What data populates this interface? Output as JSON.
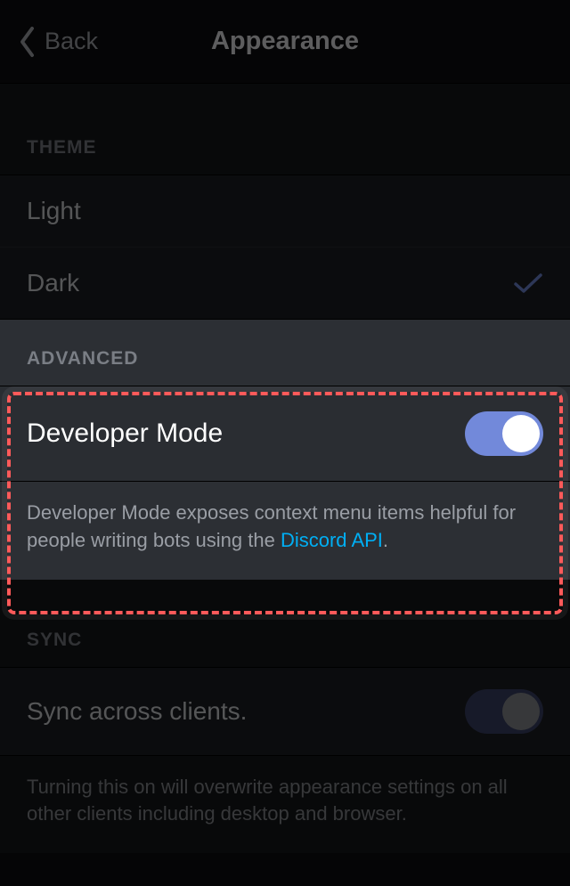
{
  "header": {
    "back_label": "Back",
    "title": "Appearance"
  },
  "sections": {
    "theme": {
      "header": "THEME",
      "options": {
        "light": {
          "label": "Light",
          "selected": false
        },
        "dark": {
          "label": "Dark",
          "selected": true
        }
      }
    },
    "advanced": {
      "header": "ADVANCED",
      "developer_mode": {
        "label": "Developer Mode",
        "enabled": true,
        "description_prefix": "Developer Mode exposes context menu items helpful for people writing bots using the ",
        "description_link_text": "Discord API",
        "description_suffix": "."
      }
    },
    "sync": {
      "header": "SYNC",
      "sync_clients": {
        "label": "Sync across clients.",
        "enabled": false,
        "description": "Turning this on will overwrite appearance settings on all other clients including desktop and browser."
      }
    }
  }
}
